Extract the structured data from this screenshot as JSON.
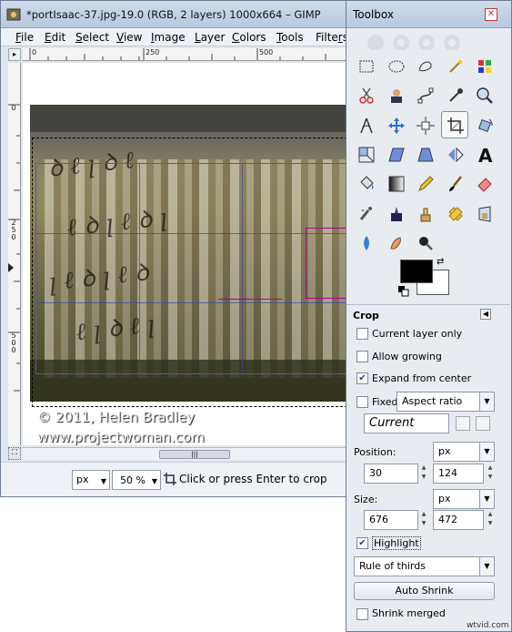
{
  "image_window": {
    "title": "*portIsaac-37.jpg-19.0 (RGB, 2 layers) 1000x664 – GIMP",
    "menu": [
      "File",
      "Edit",
      "Select",
      "View",
      "Image",
      "Layer",
      "Colors",
      "Tools",
      "Filters"
    ],
    "menu_accel": [
      "F",
      "E",
      "S",
      "V",
      "I",
      "L",
      "C",
      "T",
      "r"
    ],
    "ruler_h": [
      "0",
      "250",
      "500"
    ],
    "ruler_v": [
      "0",
      "250",
      "500"
    ],
    "watermark_line1": "© 2011, Helen Bradley",
    "watermark_line2": "www.projectwoman.com",
    "status": {
      "unit": "px",
      "zoom": "50 %",
      "message": "Click or press Enter to crop"
    }
  },
  "toolbox": {
    "title": "Toolbox",
    "tool_icons": [
      "rect-select-icon",
      "ellipse-select-icon",
      "free-select-icon",
      "fuzzy-select-icon",
      "select-by-color-icon",
      "scissors-select-icon",
      "foreground-select-icon",
      "paths-icon",
      "color-picker-icon",
      "zoom-icon",
      "measure-icon",
      "move-icon",
      "align-icon",
      "crop-icon",
      "rotate-icon",
      "scale-icon",
      "shear-icon",
      "perspective-icon",
      "flip-icon",
      "text-icon",
      "bucket-fill-icon",
      "blend-icon",
      "pencil-icon",
      "paintbrush-icon",
      "eraser-icon",
      "airbrush-icon",
      "ink-icon",
      "clone-icon",
      "heal-icon",
      "perspective-clone-icon",
      "blur-icon",
      "smudge-icon",
      "dodge-burn-icon"
    ],
    "active_tool": "crop-icon",
    "fg_color": "#000000",
    "bg_color": "#ffffff"
  },
  "crop_options": {
    "heading": "Crop",
    "current_layer_only": {
      "label": "Current layer only",
      "checked": false
    },
    "allow_growing": {
      "label": "Allow growing",
      "checked": false
    },
    "expand_from_center": {
      "label": "Expand from center",
      "checked": true
    },
    "fixed": {
      "label": "Fixed:",
      "checked": false,
      "value": "Aspect ratio"
    },
    "preset": "Current",
    "position": {
      "label": "Position:",
      "unit": "px",
      "x": "30",
      "y": "124"
    },
    "size": {
      "label": "Size:",
      "unit": "px",
      "w": "676",
      "h": "472"
    },
    "highlight": {
      "label": "Highlight",
      "checked": true
    },
    "guides": "Rule of thirds",
    "auto_shrink": "Auto Shrink",
    "shrink_merged": {
      "label": "Shrink merged",
      "checked": false
    }
  },
  "watermark_corner": "wtvid.com",
  "colors": {
    "accent": "#1f3c88",
    "handle": "#b00090",
    "titlebar": "#c4d4e8"
  }
}
